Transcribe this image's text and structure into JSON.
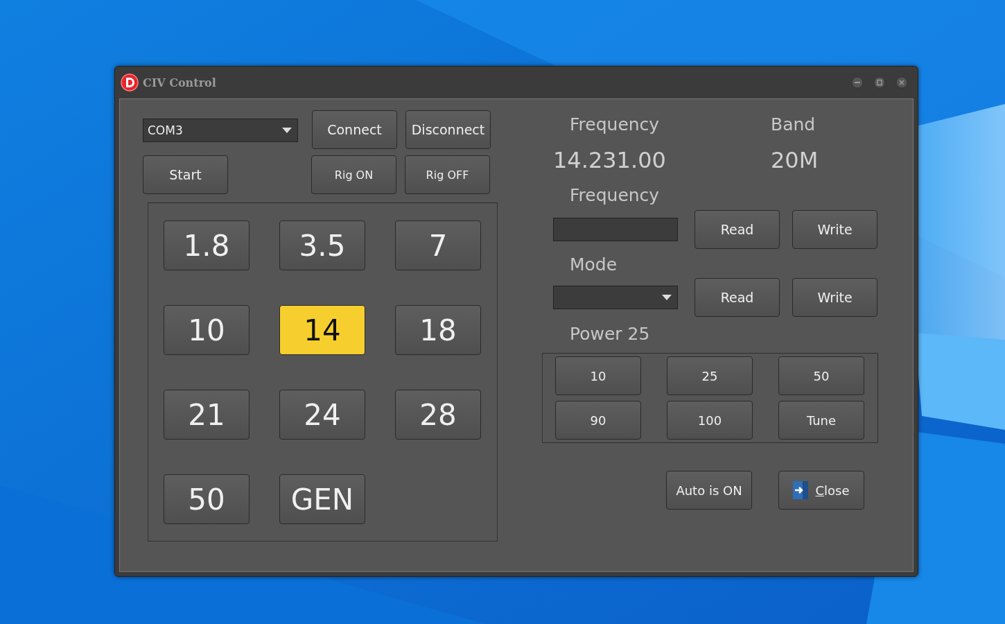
{
  "window": {
    "title": "CIV Control"
  },
  "port": {
    "value": "COM3"
  },
  "connection_buttons": [
    "Connect",
    "Disconnect"
  ],
  "start_button": "Start",
  "rig_buttons": [
    "Rig ON",
    "Rig OFF"
  ],
  "bands": [
    {
      "label": "1.8",
      "selected": false
    },
    {
      "label": "3.5",
      "selected": false
    },
    {
      "label": "7",
      "selected": false
    },
    {
      "label": "10",
      "selected": false
    },
    {
      "label": "14",
      "selected": true
    },
    {
      "label": "18",
      "selected": false
    },
    {
      "label": "21",
      "selected": false
    },
    {
      "label": "24",
      "selected": false
    },
    {
      "label": "28",
      "selected": false
    },
    {
      "label": "50",
      "selected": false
    },
    {
      "label": "GEN",
      "selected": false
    }
  ],
  "display": {
    "frequency_label": "Frequency",
    "band_label": "Band",
    "frequency": "14.231.00",
    "band": "20M"
  },
  "frequency_control": {
    "label": "Frequency",
    "read": "Read",
    "write": "Write"
  },
  "mode_control": {
    "label": "Mode",
    "read": "Read",
    "write": "Write"
  },
  "power": {
    "label": "Power 25",
    "buttons": [
      "10",
      "25",
      "50",
      "90",
      "100",
      "Tune"
    ]
  },
  "auto_button": "Auto is ON",
  "close_button": "Close"
}
